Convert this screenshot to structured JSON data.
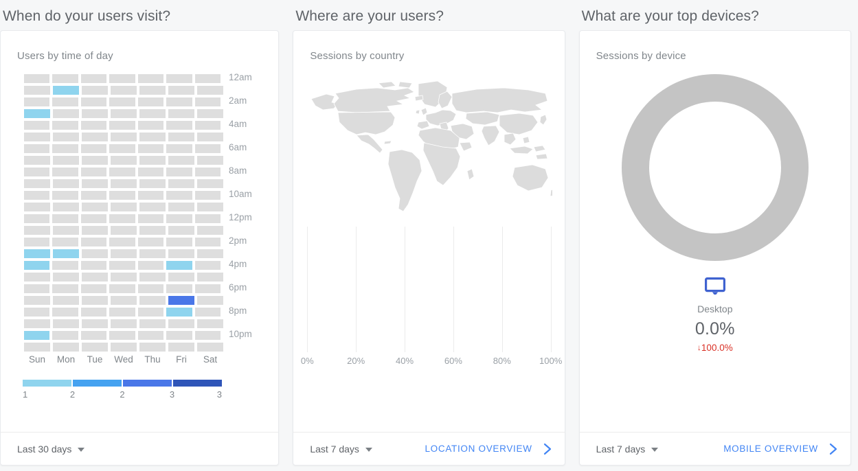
{
  "panels": [
    {
      "section_title": "When do your users visit?",
      "card_title": "Users by time of day",
      "footer": {
        "date_range": "Last 30 days",
        "link_label": ""
      }
    },
    {
      "section_title": "Where are your users?",
      "card_title": "Sessions by country",
      "footer": {
        "date_range": "Last 7 days",
        "link_label": "LOCATION OVERVIEW"
      }
    },
    {
      "section_title": "What are your top devices?",
      "card_title": "Sessions by device",
      "footer": {
        "date_range": "Last 7 days",
        "link_label": "MOBILE OVERVIEW"
      }
    }
  ],
  "device": {
    "icon": "desktop-monitor-icon",
    "label": "Desktop",
    "value": "0.0%",
    "change": "100.0%",
    "change_arrow": "↓",
    "change_color": "#d93025",
    "icon_color": "#3f62d0"
  },
  "colors": {
    "empty_cell": "#dedede",
    "donut_grey": "#c4c4c4",
    "map_grey": "#dcdcdc",
    "link_blue": "#4285f4",
    "grid_line": "#ebebeb"
  },
  "chart_data": [
    {
      "type": "heatmap",
      "title": "Users by time of day",
      "xlabel": "",
      "ylabel": "",
      "categories": [
        "Sun",
        "Mon",
        "Tue",
        "Wed",
        "Thu",
        "Fri",
        "Sat"
      ],
      "row_labels": [
        "12am",
        "",
        "2am",
        "",
        "4am",
        "",
        "6am",
        "",
        "8am",
        "",
        "10am",
        "",
        "12pm",
        "",
        "2pm",
        "",
        "4pm",
        "",
        "6pm",
        "",
        "8pm",
        "",
        "10pm",
        ""
      ],
      "hours": [
        "12am",
        "1am",
        "2am",
        "3am",
        "4am",
        "5am",
        "6am",
        "7am",
        "8am",
        "9am",
        "10am",
        "11am",
        "12pm",
        "1pm",
        "2pm",
        "3pm",
        "4pm",
        "5pm",
        "6pm",
        "7pm",
        "8pm",
        "9pm",
        "10pm",
        "11pm"
      ],
      "values": [
        [
          0,
          0,
          0,
          0,
          0,
          0,
          0
        ],
        [
          0,
          1,
          0,
          0,
          0,
          0,
          0
        ],
        [
          0,
          0,
          0,
          0,
          0,
          0,
          0
        ],
        [
          1,
          0,
          0,
          0,
          0,
          0,
          0
        ],
        [
          0,
          0,
          0,
          0,
          0,
          0,
          0
        ],
        [
          0,
          0,
          0,
          0,
          0,
          0,
          0
        ],
        [
          0,
          0,
          0,
          0,
          0,
          0,
          0
        ],
        [
          0,
          0,
          0,
          0,
          0,
          0,
          0
        ],
        [
          0,
          0,
          0,
          0,
          0,
          0,
          0
        ],
        [
          0,
          0,
          0,
          0,
          0,
          0,
          0
        ],
        [
          0,
          0,
          0,
          0,
          0,
          0,
          0
        ],
        [
          0,
          0,
          0,
          0,
          0,
          0,
          0
        ],
        [
          0,
          0,
          0,
          0,
          0,
          0,
          0
        ],
        [
          0,
          0,
          0,
          0,
          0,
          0,
          0
        ],
        [
          0,
          0,
          0,
          0,
          0,
          0,
          0
        ],
        [
          1,
          1,
          0,
          0,
          0,
          0,
          0
        ],
        [
          1,
          0,
          0,
          0,
          0,
          1,
          0
        ],
        [
          0,
          0,
          0,
          0,
          0,
          0,
          0
        ],
        [
          0,
          0,
          0,
          0,
          0,
          0,
          0
        ],
        [
          0,
          0,
          0,
          0,
          0,
          3,
          0
        ],
        [
          0,
          0,
          0,
          0,
          0,
          1,
          0
        ],
        [
          0,
          0,
          0,
          0,
          0,
          0,
          0
        ],
        [
          1,
          0,
          0,
          0,
          0,
          0,
          0
        ],
        [
          0,
          0,
          0,
          0,
          0,
          0,
          0
        ]
      ],
      "legend": {
        "colors": [
          "#8fd4ee",
          "#45a2f0",
          "#4a77e8",
          "#2f55b8"
        ],
        "ticks": [
          "1",
          "2",
          "2",
          "3",
          "3"
        ]
      }
    },
    {
      "type": "bar",
      "title": "Sessions by country",
      "orientation": "horizontal",
      "categories": [],
      "values": [],
      "xlabel": "",
      "ylabel": "",
      "xlim": [
        0,
        100
      ],
      "xticks": [
        "0%",
        "20%",
        "40%",
        "60%",
        "80%",
        "100%"
      ],
      "grid": true,
      "note": "no data plotted"
    },
    {
      "type": "pie",
      "subtype": "donut",
      "title": "Sessions by device",
      "labels": [
        "Desktop"
      ],
      "values": [
        0.0
      ],
      "slice_colors": [
        "#c4c4c4"
      ],
      "note": "empty / no-data ring"
    }
  ]
}
